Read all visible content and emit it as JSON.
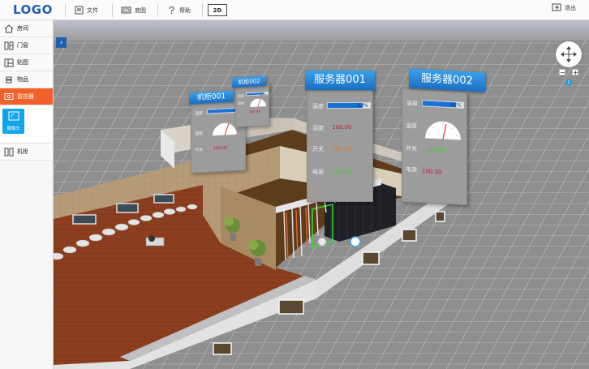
{
  "app": {
    "logo": "LOGO"
  },
  "toolbar": {
    "file_label": "文件",
    "floor_label": "底图",
    "help_label": "帮助",
    "view_mode": "2D",
    "logout_label": "退出"
  },
  "sidebar": {
    "items": [
      {
        "label": "房间",
        "icon": "house-icon"
      },
      {
        "label": "门窗",
        "icon": "door-window-icon"
      },
      {
        "label": "贴图",
        "icon": "texture-icon"
      },
      {
        "label": "物品",
        "icon": "item-icon"
      },
      {
        "label": "监控器",
        "icon": "monitor-icon"
      },
      {
        "label": "机柜",
        "icon": "cabinet-icon"
      }
    ],
    "active_item": "监控器",
    "sub_tile": {
      "label": "摄像头",
      "icon": "camera-icon"
    }
  },
  "scene": {
    "zoom_level": "1",
    "panels": {
      "cabinet1": {
        "title": "机柜001",
        "temp_label": "温度",
        "temp_value": "82%",
        "temp_level": 0.82,
        "humidity_label": "湿度",
        "switch_label": "开关",
        "switch_value": "100.00"
      },
      "cabinet2": {
        "title": "机柜002",
        "temp_label": "温度",
        "temp_value": "82%",
        "temp_level": 0.82,
        "humidity_label": "湿度",
        "switch_value": "100.00"
      },
      "server1": {
        "title": "服务器001",
        "temp_label": "温度",
        "temp_value": "82%",
        "temp_level": 0.82,
        "humidity_label": "湿度",
        "humidity_value": "100.00",
        "switch_label": "开关",
        "switch_value": "100.00",
        "power_label": "电源",
        "power_value": "100.00"
      },
      "server2": {
        "title": "服务器002",
        "temp_label": "温度",
        "temp_value": "82%",
        "temp_level": 0.82,
        "humidity_label": "湿度",
        "switch_label": "开关",
        "switch_value": "100.00",
        "power_label": "电源",
        "power_value": "100.00"
      }
    }
  },
  "colors": {
    "brand": "#1f5fb0",
    "active": "#f16129",
    "tile": "#10a5e8",
    "value_red": "#c0163a",
    "value_orange": "#d6781e",
    "value_green": "#3bd12e"
  }
}
